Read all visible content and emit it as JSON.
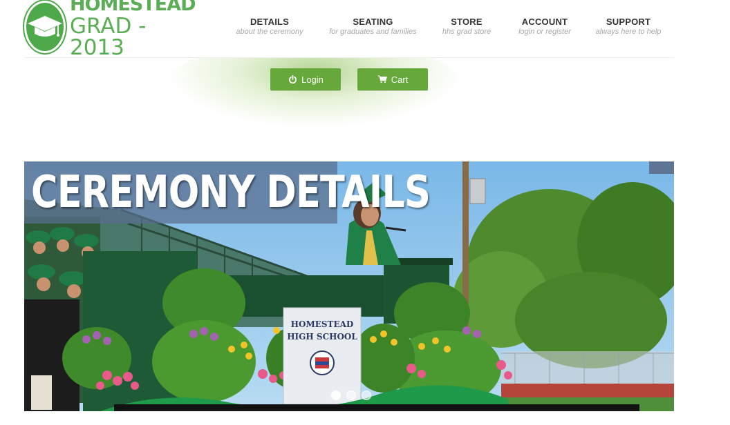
{
  "logo": {
    "line1": "HOMESTEAD",
    "line2": "GRAD - 2013",
    "icon": "graduation-cap-icon",
    "color": "#4ea94a"
  },
  "nav": [
    {
      "title": "DETAILS",
      "subtitle": "about the ceremony"
    },
    {
      "title": "SEATING",
      "subtitle": "for graduates and families"
    },
    {
      "title": "STORE",
      "subtitle": "hhs grad store"
    },
    {
      "title": "ACCOUNT",
      "subtitle": "login or register"
    },
    {
      "title": "SUPPORT",
      "subtitle": "always here to help"
    }
  ],
  "buttons": {
    "login": {
      "label": "Login",
      "icon": "power-icon"
    },
    "cart": {
      "label": "Cart",
      "icon": "cart-icon"
    },
    "color": "#66a83a"
  },
  "hero": {
    "title": "CEREMONY DETAILS",
    "podium_banner_line1": "HOMESTEAD",
    "podium_banner_line2": "HIGH SCHOOL",
    "slide_count": 3,
    "active_slide": 1
  }
}
